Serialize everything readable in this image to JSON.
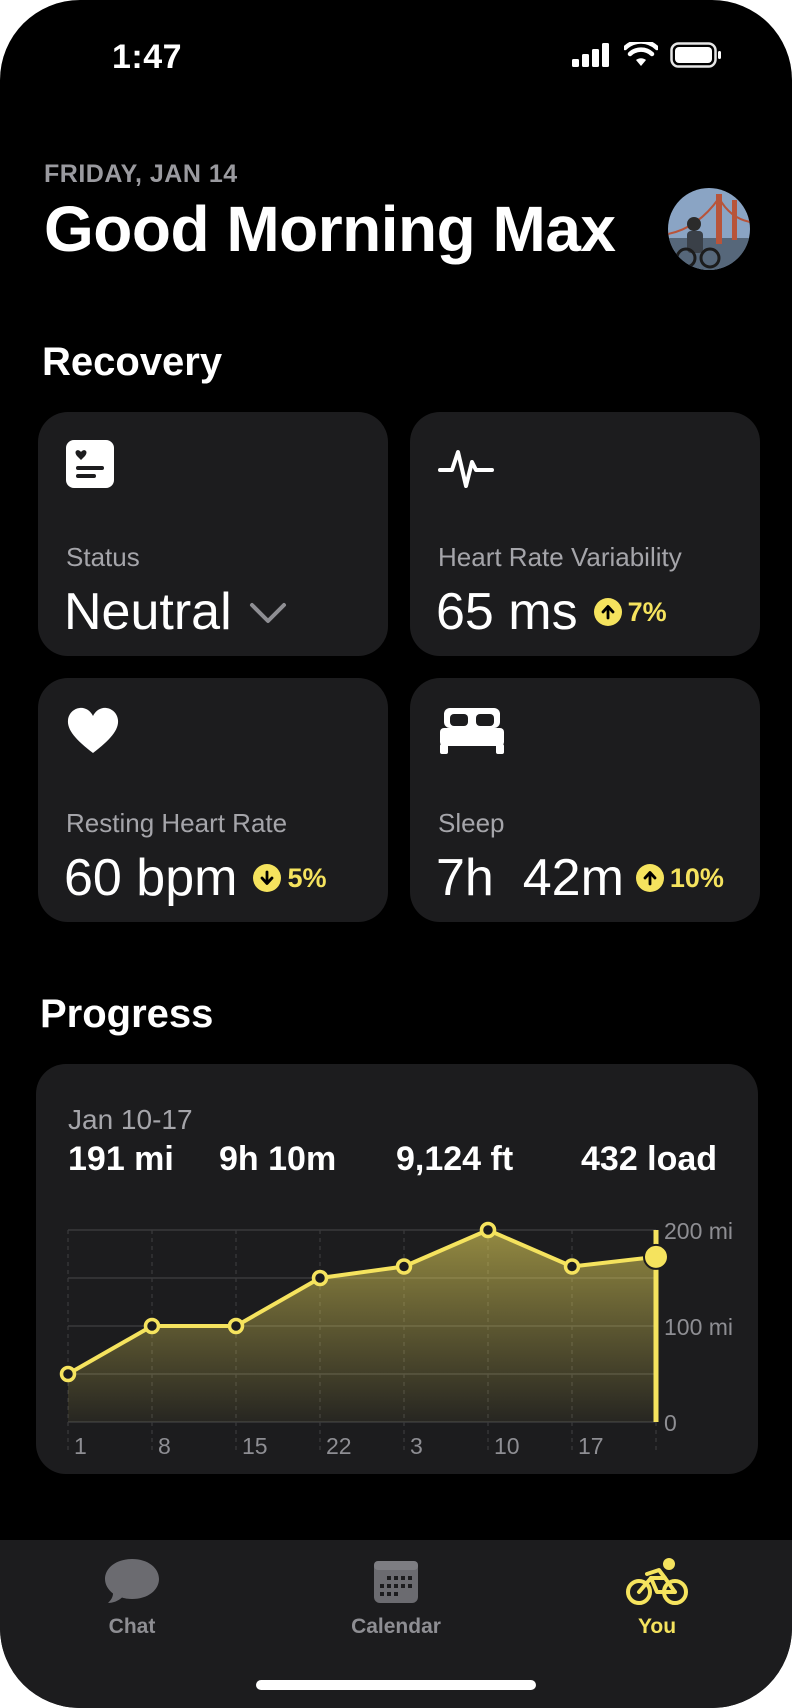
{
  "status_bar": {
    "time": "1:47"
  },
  "header": {
    "date": "FRIDAY, JAN 14",
    "greeting": "Good Morning Max"
  },
  "recovery": {
    "title": "Recovery",
    "status": {
      "icon": "heart-card-icon",
      "label": "Status",
      "value": "Neutral"
    },
    "hrv": {
      "icon": "pulse-icon",
      "label": "Heart Rate Variability",
      "value": "65 ms",
      "change": "7%",
      "direction": "up"
    },
    "resting_hr": {
      "icon": "heart-icon",
      "label": "Resting Heart Rate",
      "value": "60 bpm",
      "change": "5%",
      "direction": "down"
    },
    "sleep": {
      "icon": "bed-icon",
      "label": "Sleep",
      "value": "7h  42m",
      "change": "10%",
      "direction": "up"
    }
  },
  "progress": {
    "title": "Progress",
    "range": "Jan 10-17",
    "stats": {
      "distance": "191 mi",
      "time": "9h 10m",
      "elevation": "9,124 ft",
      "load": "432 load"
    }
  },
  "chart_data": {
    "type": "area",
    "categories": [
      "1",
      "8",
      "15",
      "22",
      "3",
      "10",
      "17",
      ""
    ],
    "values": [
      50,
      100,
      100,
      150,
      162,
      200,
      162,
      172
    ],
    "ylim": [
      0,
      200
    ],
    "y_ticks": [
      "200 mi",
      "100 mi",
      "0"
    ],
    "grid": true,
    "color": "#f5e35e"
  },
  "tabs": [
    {
      "label": "Chat",
      "icon": "chat-bubble-icon",
      "active": false
    },
    {
      "label": "Calendar",
      "icon": "calendar-icon",
      "active": false
    },
    {
      "label": "You",
      "icon": "cyclist-icon",
      "active": true
    }
  ],
  "colors": {
    "accent": "#f5e35e",
    "card": "#1c1c1e",
    "background": "#000000",
    "muted": "#a5a5aa"
  }
}
